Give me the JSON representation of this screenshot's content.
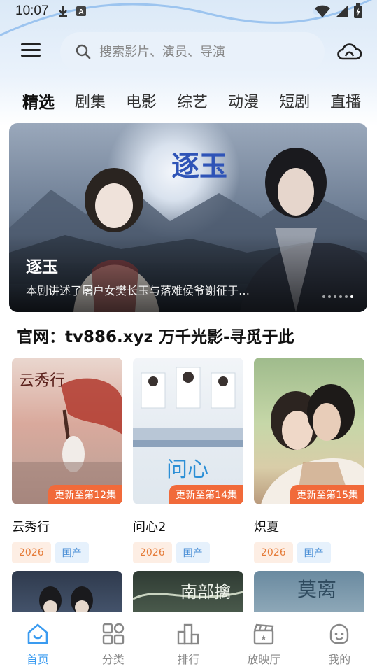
{
  "status_bar": {
    "time": "10:07"
  },
  "header": {
    "search_placeholder": "搜索影片、演员、导演"
  },
  "tabs": [
    {
      "label": "精选",
      "active": true
    },
    {
      "label": "剧集"
    },
    {
      "label": "电影"
    },
    {
      "label": "综艺"
    },
    {
      "label": "动漫"
    },
    {
      "label": "短剧"
    },
    {
      "label": "直播"
    }
  ],
  "banner": {
    "title": "逐玉",
    "description": "本剧讲述了屠户女樊长玉与落难侯爷谢征于…",
    "calligraphy": "逐玉",
    "total_slides": 6,
    "current_slide": 6
  },
  "section": {
    "title": "官网：tv886.xyz 万千光影-寻觅于此"
  },
  "cards": [
    {
      "name": "云秀行",
      "badge": "更新至第12集",
      "year": "2026",
      "region": "国产",
      "poster_text": "云秀行"
    },
    {
      "name": "问心2",
      "badge": "更新至第14集",
      "year": "2026",
      "region": "国产",
      "poster_text": "问心"
    },
    {
      "name": "炽夏",
      "badge": "更新至第15集",
      "year": "2026",
      "region": "国产",
      "poster_text": ""
    }
  ],
  "row2_poster_text": [
    "",
    "南部擒",
    "莫离"
  ],
  "bottom_nav": [
    {
      "label": "首页",
      "icon": "home-icon",
      "active": true
    },
    {
      "label": "分类",
      "icon": "category-grid-icon"
    },
    {
      "label": "排行",
      "icon": "ranking-podium-icon"
    },
    {
      "label": "放映厅",
      "icon": "clapperboard-icon"
    },
    {
      "label": "我的",
      "icon": "profile-face-icon"
    }
  ],
  "colors": {
    "accent": "#3a9bf0",
    "badge": "#f16a3a",
    "year_tag_bg": "#fdeee4",
    "year_tag_text": "#e57b38",
    "region_tag_bg": "#e6f1fc",
    "region_tag_text": "#4a8fd6"
  }
}
